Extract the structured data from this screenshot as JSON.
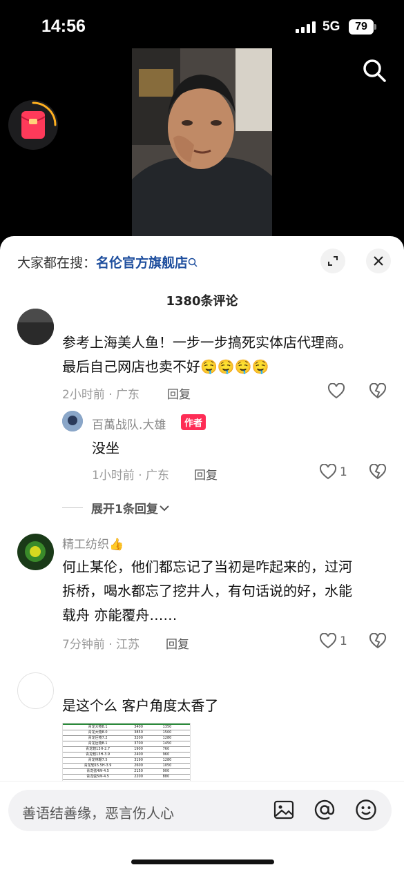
{
  "status": {
    "time": "14:56",
    "network": "5G",
    "battery": "79"
  },
  "sheet": {
    "search_prefix": "大家都在搜：",
    "search_keyword": "名伦官方旗舰店",
    "comment_count": "1380条评论"
  },
  "comments": [
    {
      "user": "",
      "text_line1": "参考上海美人鱼！一步一步搞死实体店代理商。",
      "text_line2": "最后自己网店也卖不好🤤🤤🤤🤤",
      "meta": "2小时前 · 广东",
      "reply": "回复"
    },
    {
      "user": "百萬战队.大雄",
      "tag": "作者",
      "text": "没坐",
      "meta": "1小时前 · 广东",
      "reply": "回复",
      "likes": "1"
    },
    {
      "user": "精工纺织👍",
      "text_line1": "何止某伦，他们都忘记了当初是咋起来的，过河",
      "text_line2": "拆桥，喝水都忘了挖井人，有句话说的好，水能",
      "text_line3": "载舟 亦能覆舟……",
      "meta": "7分钟前 · 江苏",
      "reply": "回复",
      "likes": "1"
    },
    {
      "user": "",
      "text": "是这个么  客户角度太香了"
    }
  ],
  "expand_label": "展开1条回复",
  "table_rows": [
    [
      "青龙大物8.1",
      "3400",
      "1350"
    ],
    [
      "青龙大物8.0",
      "3850",
      "1500"
    ],
    [
      "青龙巨物7.2",
      "3200",
      "1280"
    ],
    [
      "青龙巨物8.1",
      "3700",
      "1450"
    ],
    [
      "青龙轫13H-2.7",
      "1900",
      "760"
    ],
    [
      "青龙轫13H-3.9",
      "2400",
      "960"
    ],
    [
      "青龙林鞭7.5",
      "3190",
      "1280"
    ],
    [
      "青龙轫15.5H-3.9",
      "2600",
      "1050"
    ],
    [
      "青龙弦4W-4.5",
      "2150",
      "900"
    ],
    [
      "青龙弦5W-4.5",
      "2200",
      "880"
    ]
  ],
  "input_placeholder": "善语结善缘，恶言伤人心",
  "colors": {
    "keyword": "#1f4f9e",
    "author_tag": "#fe2c55"
  }
}
